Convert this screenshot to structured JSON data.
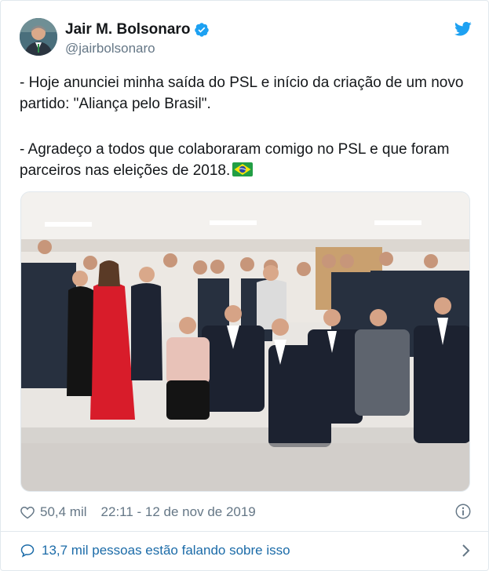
{
  "tweet": {
    "author_name": "Jair M. Bolsonaro",
    "handle": "@jairbolsonaro",
    "text_line1": "- Hoje anunciei minha saída do PSL e início da criação de um novo partido: \"Aliança pelo Brasil\".",
    "text_line2": "- Agradeço a todos que colaboraram comigo no PSL e que foram parceiros nas eleições de 2018.",
    "likes": "50,4 mil",
    "timestamp": "22:11 - 12 de nov de 2019",
    "conversation": "13,7 mil pessoas estão falando sobre isso"
  },
  "icons": {
    "verified": "verified-badge-icon",
    "logo": "twitter-bird-icon",
    "flag": "brazil-flag-emoji",
    "like": "heart-icon",
    "info": "info-icon",
    "reply": "speech-bubble-icon",
    "chevron": "chevron-right-icon"
  },
  "colors": {
    "brand_blue": "#1da1f2",
    "link_blue": "#1b6ba8",
    "secondary_text": "#657786",
    "primary_text": "#14171a"
  }
}
